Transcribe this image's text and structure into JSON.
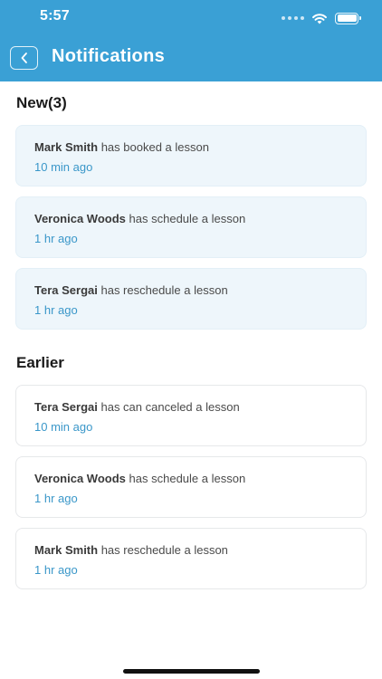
{
  "status_bar": {
    "time": "5:57"
  },
  "header": {
    "title": "Notifications",
    "back_icon": "chevron-left-icon"
  },
  "sections": {
    "new": {
      "title": "New(3)",
      "items": [
        {
          "name": "Mark Smith",
          "action": "has booked a lesson",
          "time": "10 min ago"
        },
        {
          "name": "Veronica Woods",
          "action": "has schedule a lesson",
          "time": "1 hr ago"
        },
        {
          "name": "Tera Sergai",
          "action": "has reschedule a lesson",
          "time": "1 hr ago"
        }
      ]
    },
    "earlier": {
      "title": "Earlier",
      "items": [
        {
          "name": "Tera Sergai",
          "action": "has can canceled a lesson",
          "time": "10 min ago"
        },
        {
          "name": "Veronica Woods",
          "action": "has schedule a lesson",
          "time": "1 hr ago"
        },
        {
          "name": "Mark Smith",
          "action": "has reschedule a lesson",
          "time": "1 hr ago"
        }
      ]
    }
  },
  "colors": {
    "header": "#3aa0d5",
    "new_card_bg": "#eef6fb",
    "time_text": "#3a97c9"
  }
}
